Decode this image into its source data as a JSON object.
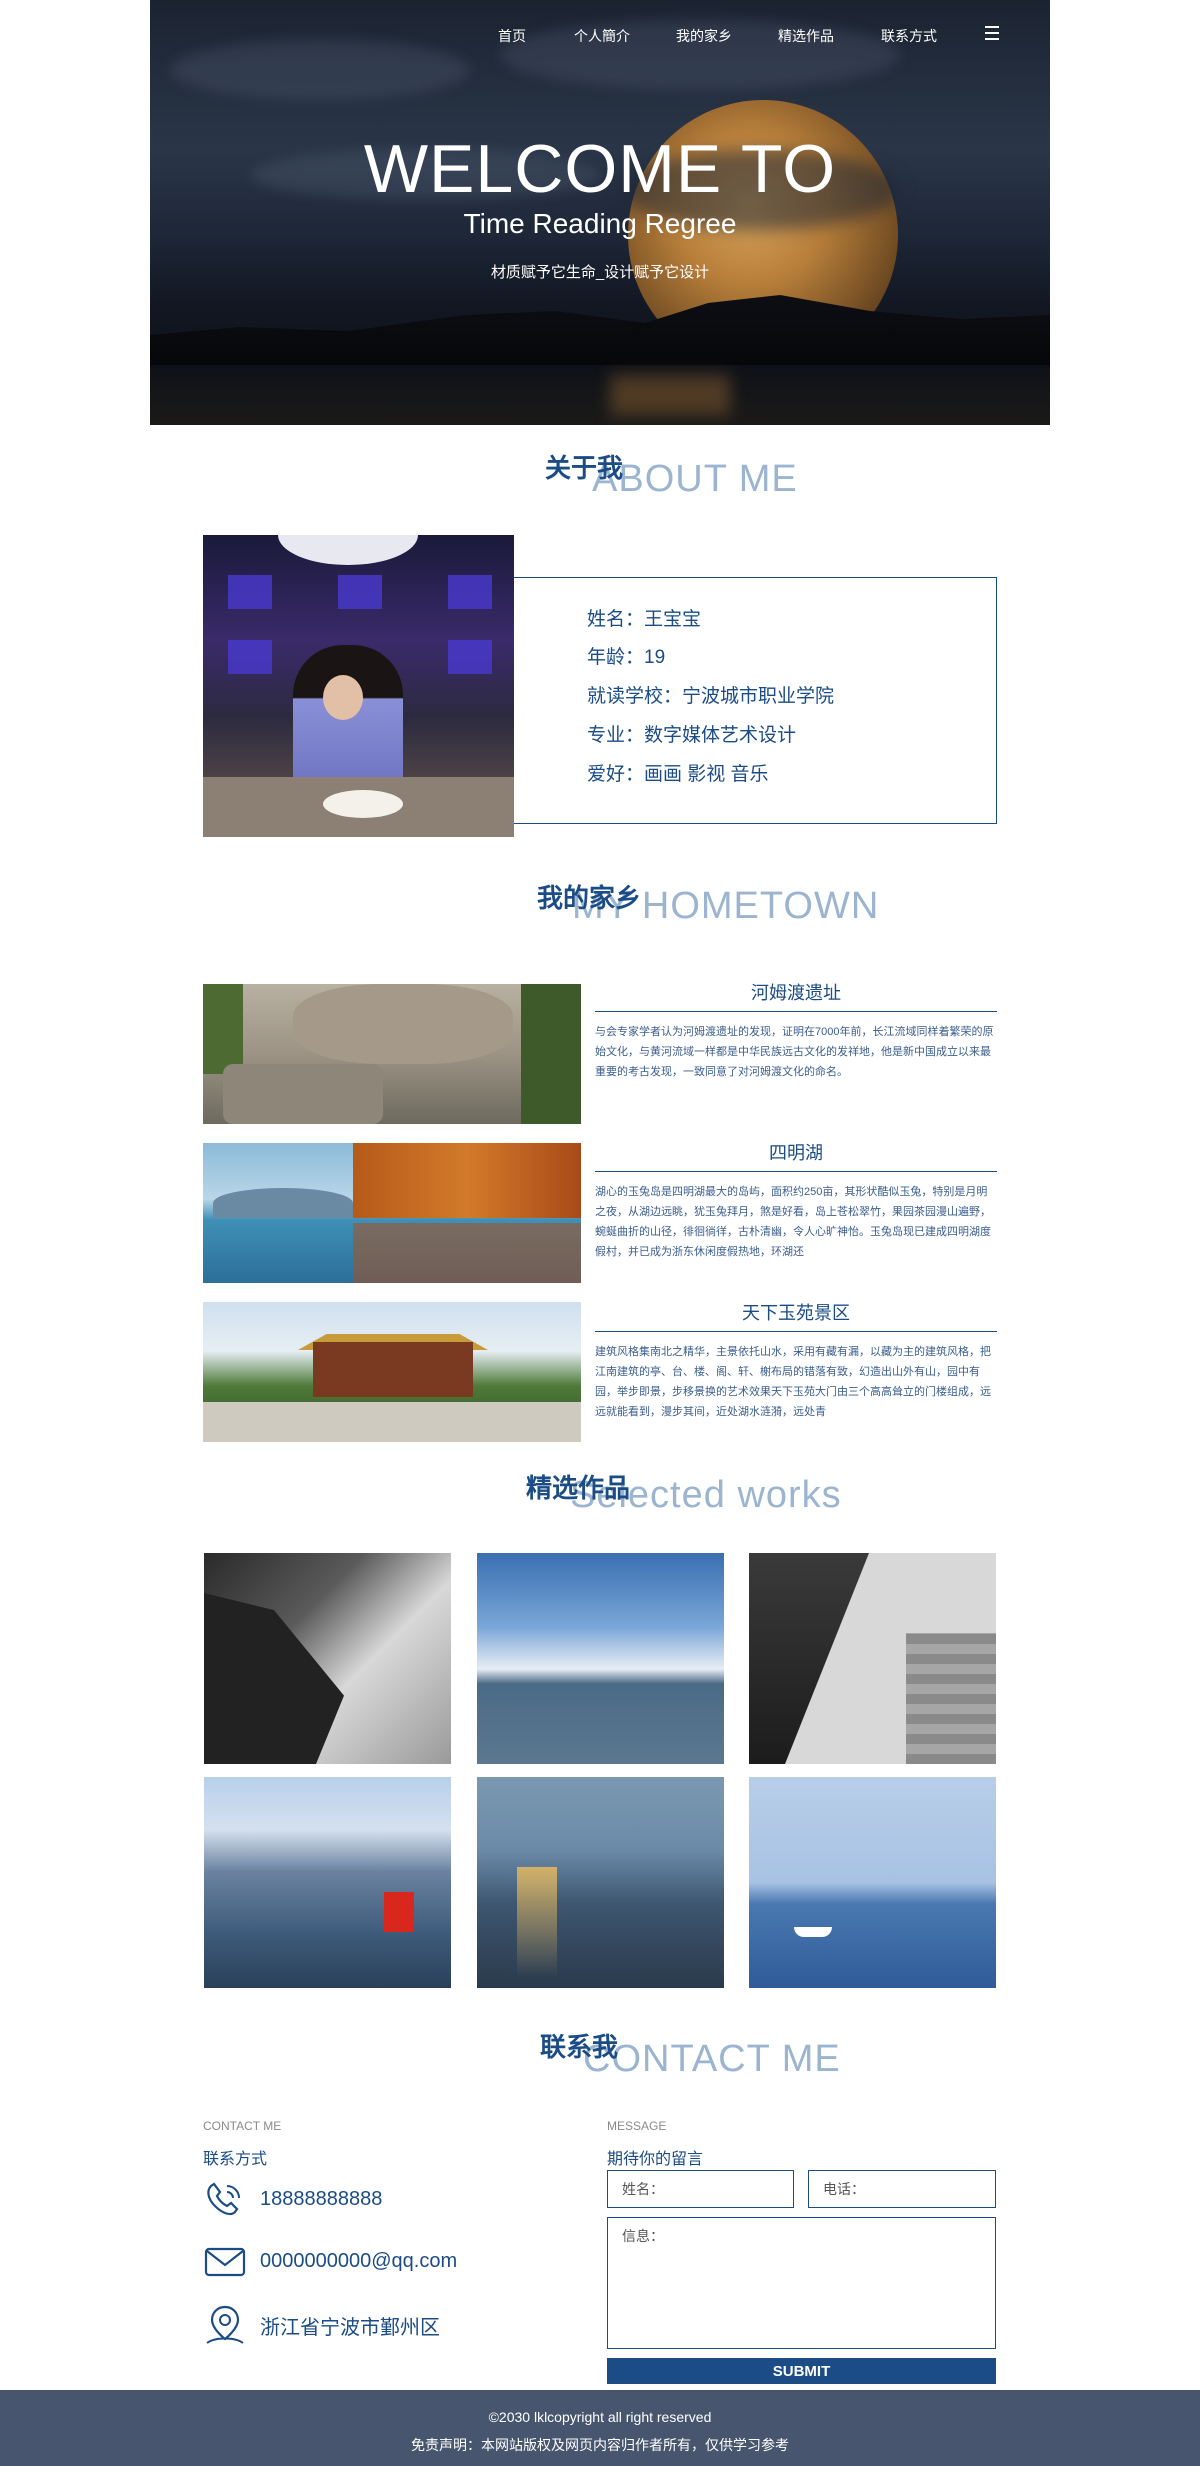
{
  "nav": {
    "items": [
      "首页",
      "个人簡介",
      "我的家乡",
      "精选作品",
      "联系方式"
    ],
    "menu_icon": "hamburger-menu-icon"
  },
  "hero": {
    "title": "WELCOME TO",
    "subtitle": "Time Reading Regree",
    "tagline": "材质赋予它生命_设计赋予它设计"
  },
  "about": {
    "title_cn": "关于我",
    "title_en": "ABOUT ME",
    "lines": [
      "姓名：王宝宝",
      "年龄：19",
      "就读学校：宁波城市职业学院",
      "专业：数字媒体艺术设计",
      "爱好：画画 影视 音乐"
    ]
  },
  "hometown": {
    "title_cn": "我的家乡",
    "title_en": "MY HOMETOWN",
    "items": [
      {
        "name": "河姆渡遗址",
        "desc": "与会专家学者认为河姆渡遗址的发现，证明在7000年前，长江流域同样着繁荣的原始文化，与黄河流域一样都是中华民族远古文化的发祥地，他是新中国成立以来最重要的考古发现，一致同意了对河姆渡文化的命名。"
      },
      {
        "name": "四明湖",
        "desc": "湖心的玉兔岛是四明湖最大的岛屿，面积约250亩，其形状酷似玉兔，特别是月明之夜，从湖边远眺，犹玉兔拜月，煞是好看，岛上苍松翠竹，果园茶园漫山遍野，蜿蜒曲折的山径，徘徊徜徉，古朴清幽，令人心旷神怡。玉兔岛现已建成四明湖度假村，并已成为浙东休闲度假热地，环湖还"
      },
      {
        "name": "天下玉苑景区",
        "desc": "建筑风格集南北之精华，主景依托山水，采用有藏有漏，以藏为主的建筑风格，把江南建筑的亭、台、楼、阁、轩、榭布局的错落有致，幻造出山外有山，园中有园，举步即景，步移景换的艺术效果天下玉苑大门由三个高高耸立的门楼组成，远远就能看到，漫步其间，近处湖水涟漪，远处青"
      }
    ]
  },
  "works": {
    "title_cn": "精选作品",
    "title_en": "Selected works",
    "items": [
      "rocky-shore-photo",
      "sea-horizon-photo",
      "architecture-photo",
      "mountain-flag-photo",
      "sunset-boat-photo",
      "sea-boat-photo"
    ]
  },
  "contact": {
    "title_cn": "联系我",
    "title_en": "CONTACT ME",
    "left_small": "CONTACT ME",
    "left_label": "联系方式",
    "phone": "18888888888",
    "email": "0000000000@qq.com",
    "address": "浙江省宁波市鄞州区",
    "right_small": "MESSAGE",
    "right_label": "期待你的留言",
    "name_placeholder": "姓名：",
    "phone_placeholder": "电话：",
    "message_placeholder": "信息：",
    "submit_label": "SUBMIT"
  },
  "footer": {
    "copyright": "©2030 lklcopyright all right reserved",
    "disclaimer": "免责声明：本网站版权及网页内容归作者所有，仅供学习参考"
  },
  "colors": {
    "primary": "#1b4c86",
    "accent_light": "#9bb4cf",
    "footer_bg": "#47566e"
  }
}
